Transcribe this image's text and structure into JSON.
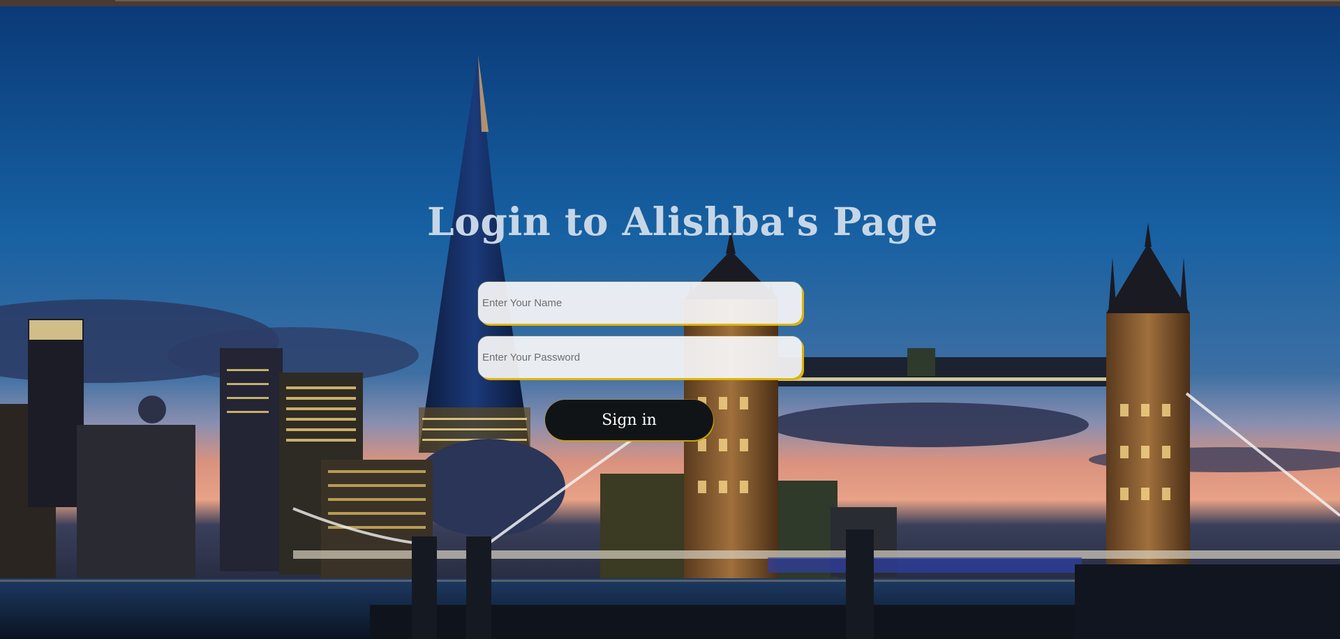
{
  "page": {
    "title": "Login to Alishba's Page"
  },
  "form": {
    "name_placeholder": "Enter Your Name",
    "name_value": "",
    "password_placeholder": "Enter Your Password",
    "password_value": "",
    "signin_label": "Sign in"
  },
  "colors": {
    "title_text": "#c6d6e6",
    "field_accent": "#e0b400",
    "button_bg": "#111417",
    "sky_top": "#0b3d7a",
    "sky_horizon": "#e59a7a"
  },
  "background": {
    "icon": "city-skyline-image"
  }
}
